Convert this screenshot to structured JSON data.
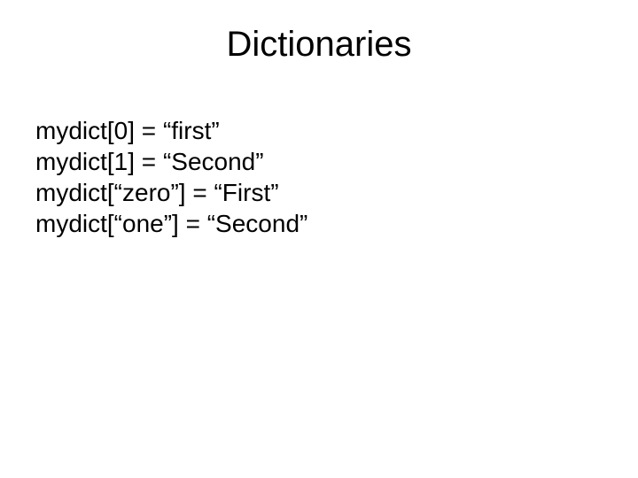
{
  "title": "Dictionaries",
  "lines": {
    "l0": "mydict[0] = “first”",
    "l1": "mydict[1] = “Second”",
    "l2": "mydict[“zero”] = “First”",
    "l3": "mydict[“one”] = “Second”"
  }
}
